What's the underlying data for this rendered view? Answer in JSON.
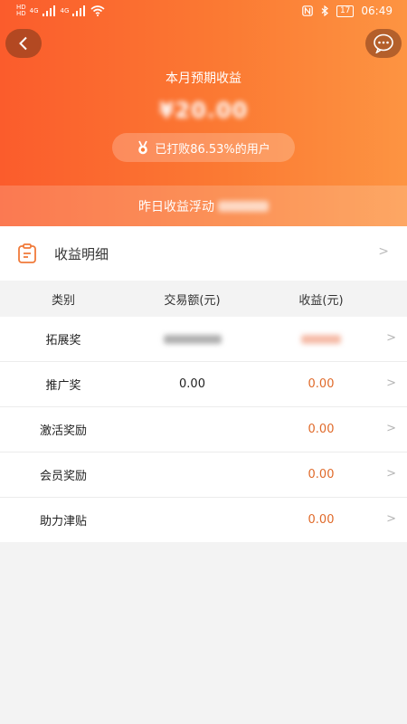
{
  "status_bar": {
    "sim1": "HD",
    "sim2": "HD",
    "network1": "4G",
    "network2": "4G",
    "battery": "17",
    "time": "06:49"
  },
  "header": {
    "title": "本月预期收益",
    "amount": "¥20.00",
    "badge_text": "已打败86.53%的用户",
    "yesterday_label": "昨日收益浮动"
  },
  "detail": {
    "label": "收益明细",
    "chevron": ">"
  },
  "table": {
    "headers": [
      "类别",
      "交易额(元)",
      "收益(元)"
    ],
    "rows": [
      {
        "category": "拓展奖",
        "volume": "",
        "gain": "",
        "chevron": ">"
      },
      {
        "category": "推广奖",
        "volume": "0.00",
        "gain": "0.00",
        "chevron": ">"
      },
      {
        "category": "激活奖励",
        "volume": "",
        "gain": "0.00",
        "chevron": ">"
      },
      {
        "category": "会员奖励",
        "volume": "",
        "gain": "0.00",
        "chevron": ">"
      },
      {
        "category": "助力津贴",
        "volume": "",
        "gain": "0.00",
        "chevron": ">"
      }
    ]
  },
  "colors": {
    "hero_start": "#fb5c2c",
    "hero_end": "#fd9442",
    "gain_text": "#e06a2a"
  }
}
